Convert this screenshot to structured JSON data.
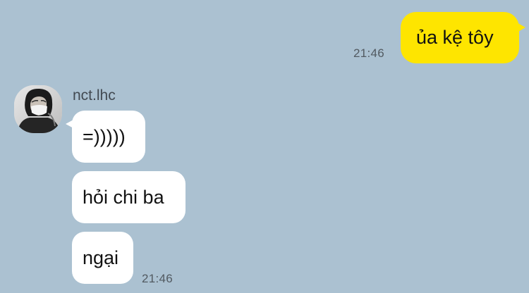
{
  "chat": {
    "outgoing": [
      {
        "text": "ủa kệ tôy",
        "time": "21:46"
      }
    ],
    "incoming": {
      "sender_name": "nct.lhc",
      "avatar_icon": "profile-photo-masked-person",
      "messages": [
        {
          "text": "=)))))"
        },
        {
          "text": "hỏi chi ba"
        },
        {
          "text": "ngại"
        }
      ],
      "time": "21:46"
    }
  },
  "colors": {
    "background": "#abc1d1",
    "outgoing_bubble": "#fee500",
    "incoming_bubble": "#ffffff",
    "text": "#121212",
    "timestamp": "#525a61"
  }
}
